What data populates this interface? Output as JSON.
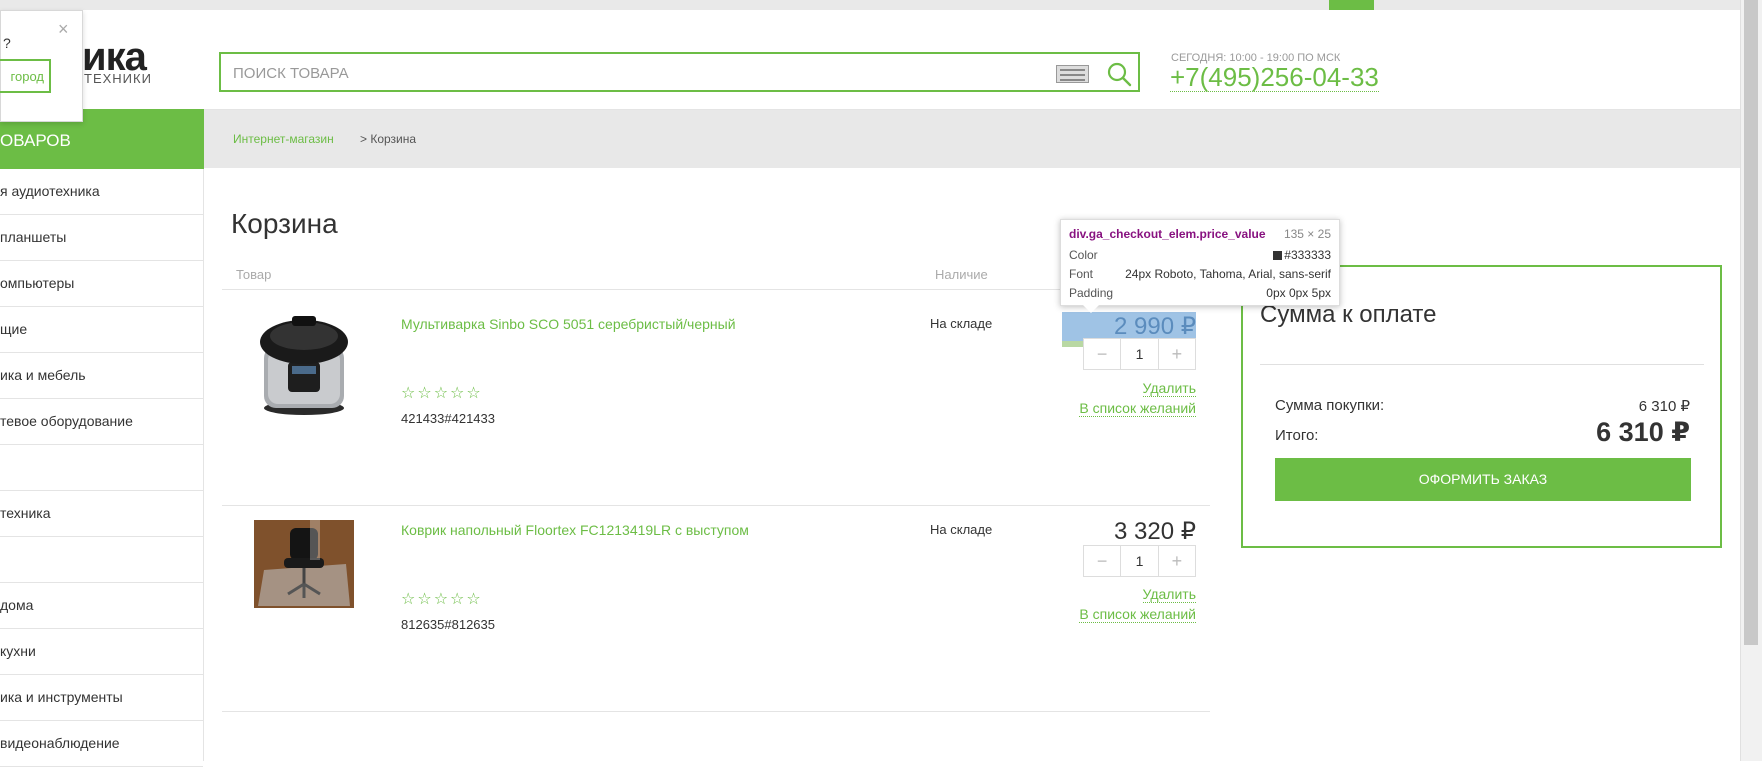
{
  "header": {
    "logo_text": "ика",
    "logo_sub": "ТЕХНИКИ",
    "city_question": "?",
    "city_button": "город",
    "city_close": "×",
    "search_placeholder": "ПОИСК ТОВАРА",
    "hours": "СЕГОДНЯ: 10:00 - 19:00 ПО МСК",
    "phone": "+7(495)256-04-33"
  },
  "sidebar": {
    "title": "ОВАРОВ",
    "items": [
      {
        "label": "я аудиотехника"
      },
      {
        "label": " планшеты"
      },
      {
        "label": "омпьютеры"
      },
      {
        "label": "щие"
      },
      {
        "label": "ика и мебель"
      },
      {
        "label": "тевое оборудование"
      },
      {
        "label": ""
      },
      {
        "label": "техника"
      },
      {
        "label": ""
      },
      {
        "label": "дома"
      },
      {
        "label": "кухни"
      },
      {
        "label": "ика и инструменты"
      },
      {
        "label": " видеонаблюдение"
      }
    ]
  },
  "breadcrumb": {
    "link": "Интернет-магазин",
    "current": "> Корзина"
  },
  "page": {
    "title": "Корзина"
  },
  "cart": {
    "columns": {
      "product": "Товар",
      "availability": "Наличие"
    },
    "items": [
      {
        "name": "Мультиварка Sinbo SCO 5051 серебристый/черный",
        "stars": "☆☆☆☆☆",
        "sku": "421433#421433",
        "availability": "На складе",
        "price": "2 990 ₽",
        "qty": "1",
        "minus": "−",
        "plus": "+",
        "remove": "Удалить",
        "wishlist": "В список желаний"
      },
      {
        "name": "Коврик напольный Floortex FC1213419LR с выступом",
        "stars": "☆☆☆☆☆",
        "sku": "812635#812635",
        "availability": "На складе",
        "price": "3 320 ₽",
        "qty": "1",
        "minus": "−",
        "plus": "+",
        "remove": "Удалить",
        "wishlist": "В список желаний"
      }
    ]
  },
  "summary": {
    "title": "Сумма к оплате",
    "subtotal_label": "Сумма покупки:",
    "subtotal_value": "6 310 ₽",
    "total_label": "Итого:",
    "total_value": "6 310 ₽",
    "checkout_label": "ОФОРМИТЬ ЗАКАЗ"
  },
  "devtools_tooltip": {
    "selector": "div.ga_checkout_elem.price_value",
    "size": "135 × 25",
    "color_label": "Color",
    "color_value": "#333333",
    "font_label": "Font",
    "font_value": "24px Roboto, Tahoma, Arial, sans-serif",
    "padding_label": "Padding",
    "padding_value": "0px 0px 5px"
  },
  "colors": {
    "accent": "#6cbd45",
    "text": "#333333"
  }
}
